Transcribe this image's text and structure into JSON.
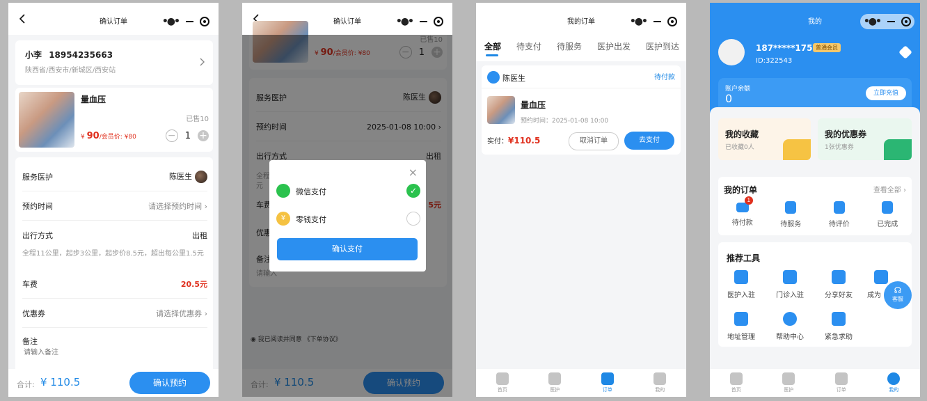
{
  "screen1": {
    "title": "确认订单",
    "contact_name": "小李",
    "contact_phone": "18954235663",
    "address": "陕西省/西安市/新城区/西安站",
    "product_name": "量血压",
    "sold": "已售10",
    "price_symbol": "¥",
    "price": "90",
    "member_price_label": "/会员价: ¥80",
    "quantity": "1",
    "rows": {
      "doctor_label": "服务医护",
      "doctor_value": "陈医生",
      "time_label": "预约时间",
      "time_value": "请选择预约时间",
      "travel_label": "出行方式",
      "travel_value": "出租",
      "travel_note": "全程11公里，起步3公里，起步价8.5元，超出每公里1.5元",
      "fare_label": "车费",
      "fare_value": "20.5元",
      "coupon_label": "优惠券",
      "coupon_value": "请选择优惠券",
      "remark_label": "备注",
      "remark_placeholder": "请输入备注"
    },
    "total_label": "合计:",
    "total_value": "¥ 110.5",
    "submit_label": "确认预约"
  },
  "screen2": {
    "title": "确认订单",
    "sold": "已售10",
    "price_symbol": "¥",
    "price": "90",
    "member_price_label": "/会员价: ¥80",
    "quantity": "1",
    "rows": {
      "doctor_label": "服务医护",
      "doctor_value": "陈医生",
      "time_label": "预约时间",
      "time_value": "2025-01-08 10:00",
      "travel_label": "出行方式",
      "travel_value": "出租",
      "travel_note": "全程",
      "travel_note_tail": "元",
      "fare_label": "车费",
      "fare_value_tail": "5元",
      "coupon_label": "优惠",
      "remark_label": "备注",
      "remark_placeholder": "请输入"
    },
    "agreement": "我已阅读并同意 《下单协议》",
    "modal": {
      "wechat": "微信支付",
      "balance": "零钱支付",
      "confirm": "确认支付"
    },
    "total_label": "合计:",
    "total_value": "¥ 110.5",
    "submit_label": "确认预约"
  },
  "screen3": {
    "title": "我的订单",
    "tabs": [
      "全部",
      "待支付",
      "待服务",
      "医护出发",
      "医护到达"
    ],
    "order": {
      "doctor": "陈医生",
      "status": "待付款",
      "product": "量血压",
      "appointment": "预约时间：2025-01-08 10:00",
      "paid_label": "实付：",
      "paid_value": "¥110.5",
      "cancel": "取消订单",
      "pay": "去支付"
    },
    "tabbar": [
      "首页",
      "医护",
      "订单",
      "我的"
    ]
  },
  "screen4": {
    "title": "我的",
    "phone": "187*****1751",
    "member_badge": "普通会员",
    "user_id": "ID:322543",
    "balance_label": "账户余额",
    "balance_value": "0",
    "recharge": "立即充值",
    "favorites_title": "我的收藏",
    "favorites_sub": "已收藏0人",
    "coupons_title": "我的优惠券",
    "coupons_sub": "1张优惠券",
    "orders_title": "我的订单",
    "view_all": "查看全部",
    "order_items": [
      "待付款",
      "待服务",
      "待评价",
      "已完成"
    ],
    "unpaid_badge": "1",
    "tools_title": "推荐工具",
    "tools": [
      "医护入驻",
      "门诊入驻",
      "分享好友",
      "成为",
      "地址管理",
      "帮助中心",
      "紧急求助"
    ],
    "service_label": "客服",
    "tabbar": [
      "首页",
      "医护",
      "订单",
      "我的"
    ],
    "colors": {
      "brand_blue": "#2b8ff0",
      "price_red": "#e0301e"
    }
  }
}
